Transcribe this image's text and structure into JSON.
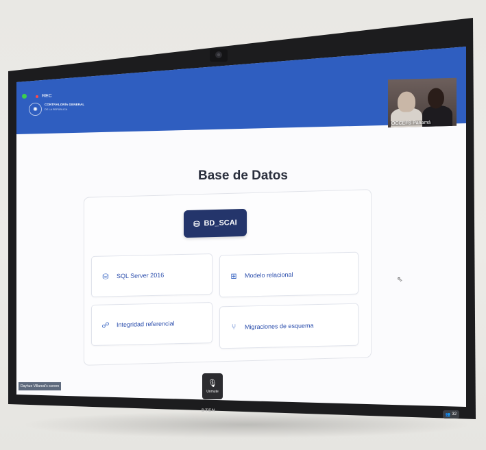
{
  "meeting": {
    "rec_label": "REC",
    "org_name": "CONTRALORÍA GENERAL",
    "org_sub": "DE LA REPÚBLICA",
    "video_tile_label": "OCCEFS Panamá",
    "screen_share_label": "Dayhue Villareal's screen",
    "unmute_label": "Unmute",
    "participants_count": "32",
    "tv_brand": "DTEN"
  },
  "slide": {
    "title": "Base de Datos",
    "database_button": "BD_SCAI",
    "features": [
      {
        "label": "SQL Server 2016",
        "icon": "database-icon"
      },
      {
        "label": "Modelo relacional",
        "icon": "table-icon"
      },
      {
        "label": "Integridad referencial",
        "icon": "link-icon"
      },
      {
        "label": "Migraciones de esquema",
        "icon": "git-branch-icon"
      }
    ]
  },
  "colors": {
    "header_blue": "#2f5ec0",
    "button_navy": "#24356b",
    "feature_text": "#2a4dac",
    "rec_green": "#3ccf4e",
    "rec_red": "#ff4a4a"
  }
}
